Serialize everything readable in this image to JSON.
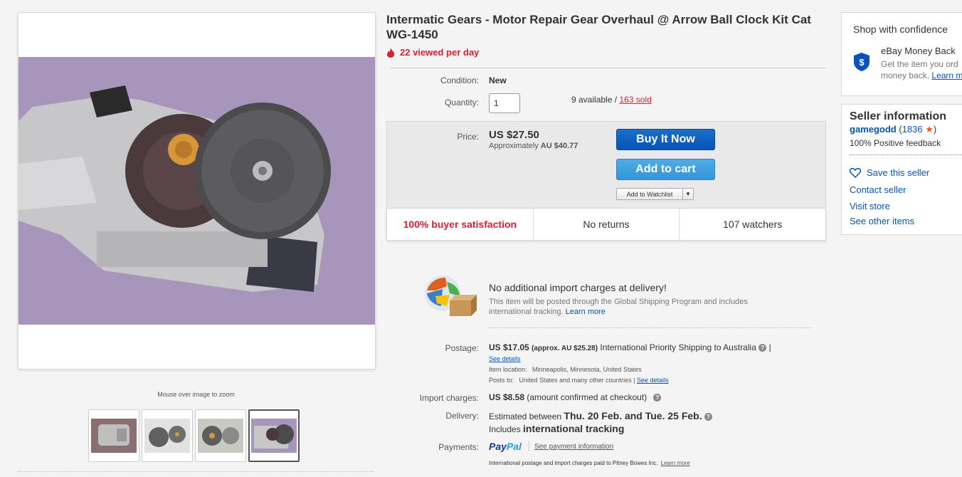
{
  "gallery": {
    "zoom_hint": "Mouse over image to zoom",
    "thumbnails": [
      "thumb-1",
      "thumb-2",
      "thumb-3",
      "thumb-4"
    ],
    "active_thumbnail": 4
  },
  "listing": {
    "title": "Intermatic Gears - Motor Repair Gear Overhaul @ Arrow Ball Clock Kit Cat WG-1450",
    "views": "22 viewed per day",
    "condition_label": "Condition:",
    "condition_value": "New",
    "quantity_label": "Quantity:",
    "quantity_value": "1",
    "available": "9 available",
    "sep": " / ",
    "sold": "163 sold",
    "price_label": "Price:",
    "price": "US $27.50",
    "approx_prefix": "Approximately",
    "approx_value": "AU $40.77",
    "buy_now": "Buy It Now",
    "add_to_cart": "Add to cart",
    "add_to_watchlist": "Add to Watchlist",
    "satisfaction": "100% buyer satisfaction",
    "returns": "No returns",
    "watchers": "107 watchers"
  },
  "shipping": {
    "import_heading": "No additional import charges at delivery!",
    "import_text": "This item will be posted through the Global Shipping Program and includes international tracking.",
    "import_learn_more": "Learn more",
    "postage_label": "Postage:",
    "postage_price": "US $17.05",
    "postage_approx": "(approx. AU $25.28)",
    "postage_service": "International Priority Shipping to Australia",
    "postage_pipe": "|",
    "see_details": "See details",
    "item_location_label": "Item location:",
    "item_location": "Minneapolis, Minnesota, United States",
    "posts_to_label": "Posts to:",
    "posts_to": "United States and many other countries |",
    "posts_to_see_details": "See details",
    "import_charges_label": "Import charges:",
    "import_charges_price": "US $8.58",
    "import_charges_note": "(amount confirmed at checkout)",
    "delivery_label": "Delivery:",
    "delivery_prefix": "Estimated between",
    "delivery_dates": "Thu. 20 Feb. and Tue. 25 Feb.",
    "tracking_prefix": "Includes",
    "tracking_bold": "international tracking",
    "payments_label": "Payments:",
    "paypal_pay": "Pay",
    "paypal_pal": "Pal",
    "see_payment": "See payment information",
    "footer_note": "International postage and import charges paid to Pitney Bowes Inc.",
    "footer_learn_more": "Learn more"
  },
  "sidebar": {
    "confidence_title": "Shop with confidence",
    "money_back_title": "eBay Money Back",
    "money_back_text_1": "Get the item you ord",
    "money_back_text_2": "money back.",
    "money_back_learn": "Learn m",
    "seller_title": "Seller information",
    "seller_name": "gamegodd",
    "seller_open": " (",
    "seller_score": "1836",
    "seller_close": ")",
    "seller_feedback": "100% Positive feedback",
    "save_seller": "Save this seller",
    "contact_seller": "Contact seller",
    "visit_store": "Visit store",
    "other_items": "See other items"
  },
  "colors": {
    "accent_red": "#dd1e31",
    "link_blue": "#0654ba",
    "buy_blue": "#0654ba",
    "cart_blue": "#3496d6",
    "star_orange": "#e35d1c"
  }
}
